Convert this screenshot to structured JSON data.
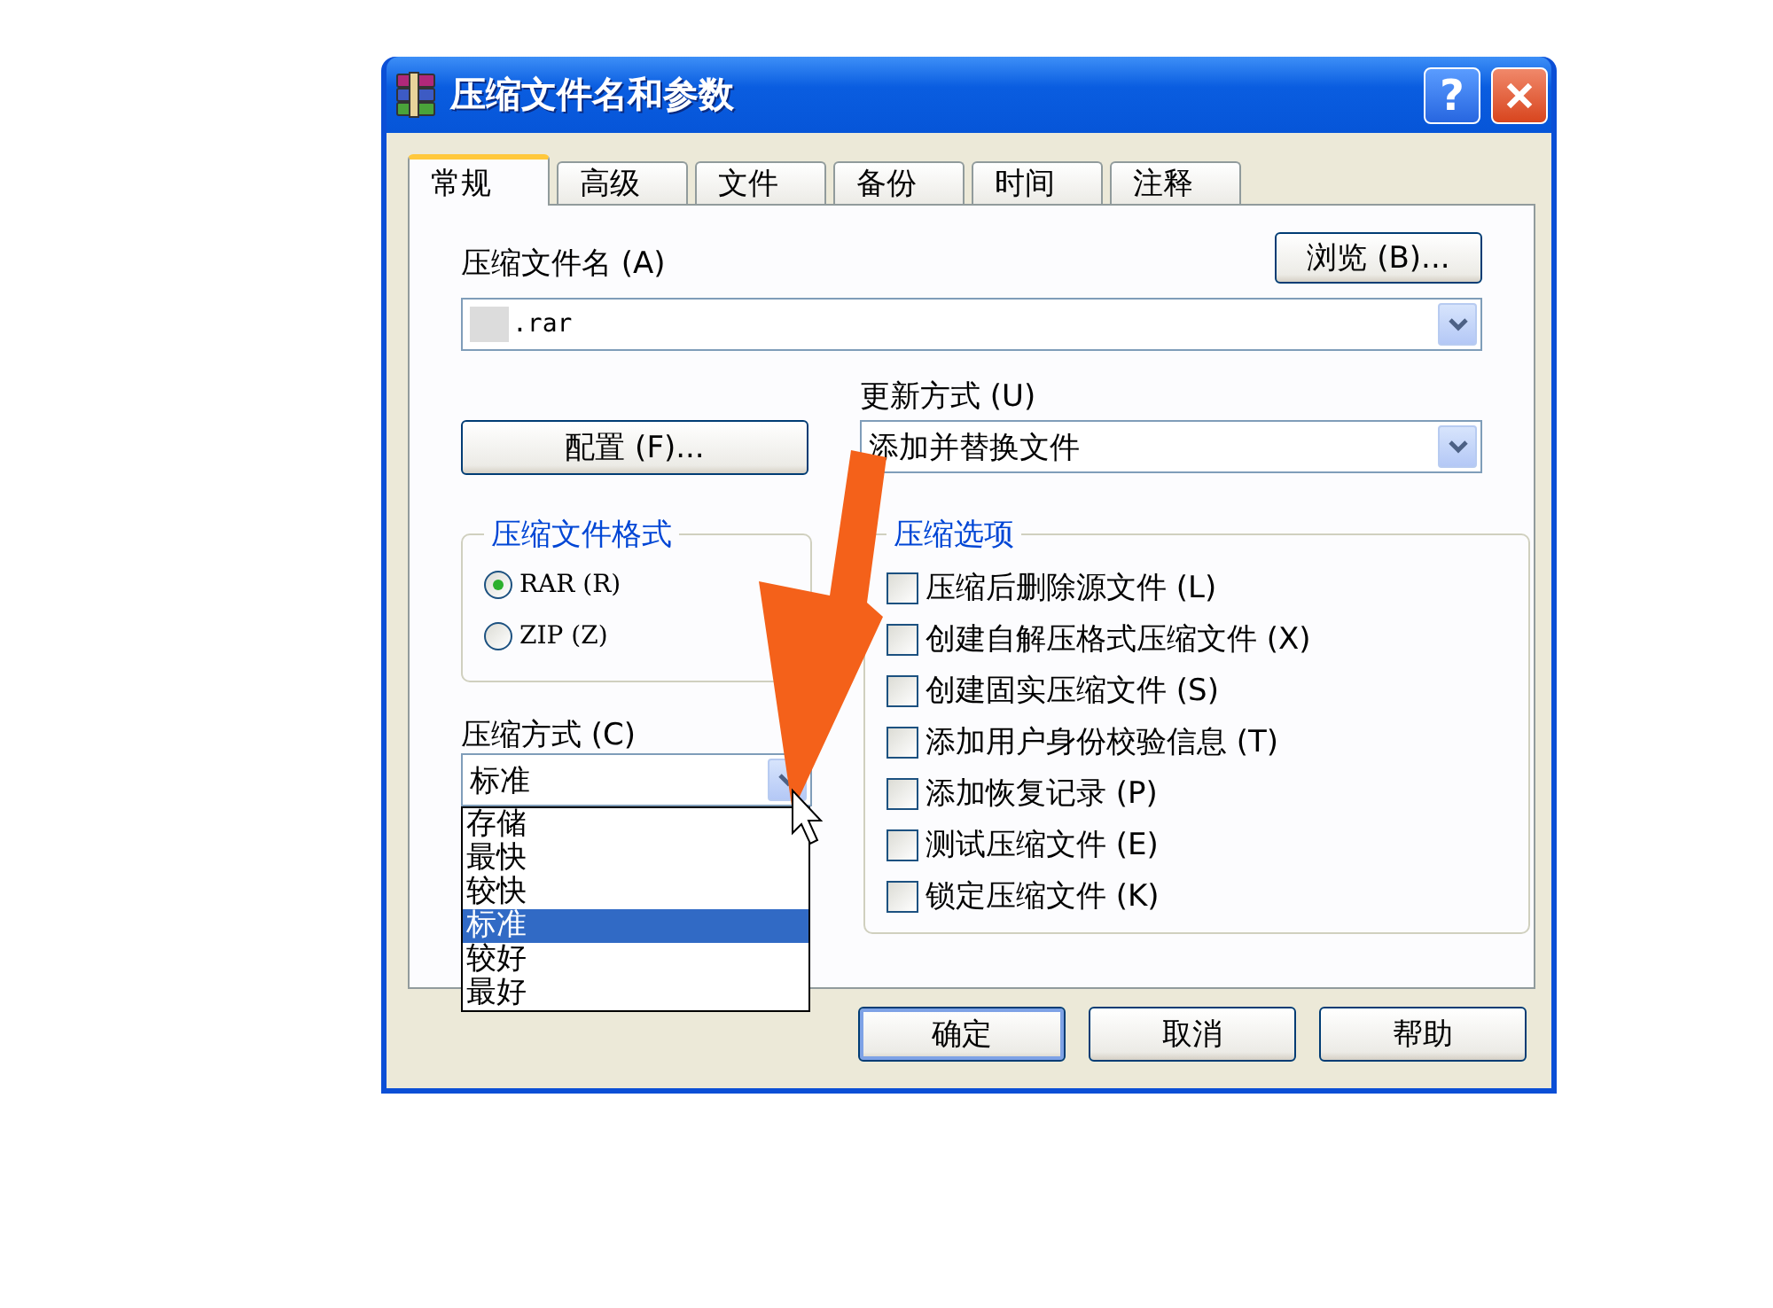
{
  "window": {
    "title": "压缩文件名和参数",
    "help_button": "?"
  },
  "tabs": [
    {
      "label": "常规",
      "selected": true
    },
    {
      "label": "高级",
      "selected": false
    },
    {
      "label": "文件",
      "selected": false
    },
    {
      "label": "备份",
      "selected": false
    },
    {
      "label": "时间",
      "selected": false
    },
    {
      "label": "注释",
      "selected": false
    }
  ],
  "archive_name": {
    "label": "压缩文件名 (A)",
    "value": ".rar",
    "browse_button": "浏览 (B)..."
  },
  "profiles_button": "配置 (F)...",
  "update_mode": {
    "label": "更新方式 (U)",
    "value": "添加并替换文件"
  },
  "archive_format": {
    "title": "压缩文件格式",
    "options": [
      {
        "label": "RAR (R)",
        "selected": true
      },
      {
        "label": "ZIP (Z)",
        "selected": false
      }
    ]
  },
  "compression_method": {
    "label": "压缩方式 (C)",
    "value": "标准",
    "dropdown": [
      {
        "label": "存储",
        "selected": false
      },
      {
        "label": "最快",
        "selected": false
      },
      {
        "label": "较快",
        "selected": false
      },
      {
        "label": "标准",
        "selected": true
      },
      {
        "label": "较好",
        "selected": false
      },
      {
        "label": "最好",
        "selected": false
      }
    ]
  },
  "archive_options": {
    "title": "压缩选项",
    "items": [
      {
        "label": "压缩后删除源文件 (L)",
        "checked": false
      },
      {
        "label": "创建自解压格式压缩文件 (X)",
        "checked": false
      },
      {
        "label": "创建固实压缩文件 (S)",
        "checked": false
      },
      {
        "label": "添加用户身份校验信息 (T)",
        "checked": false
      },
      {
        "label": "添加恢复记录 (P)",
        "checked": false
      },
      {
        "label": "测试压缩文件 (E)",
        "checked": false
      },
      {
        "label": "锁定压缩文件 (K)",
        "checked": false
      }
    ]
  },
  "buttons": [
    {
      "label": "确定",
      "default": true
    },
    {
      "label": "取消",
      "default": false
    },
    {
      "label": "帮助",
      "default": false
    }
  ]
}
